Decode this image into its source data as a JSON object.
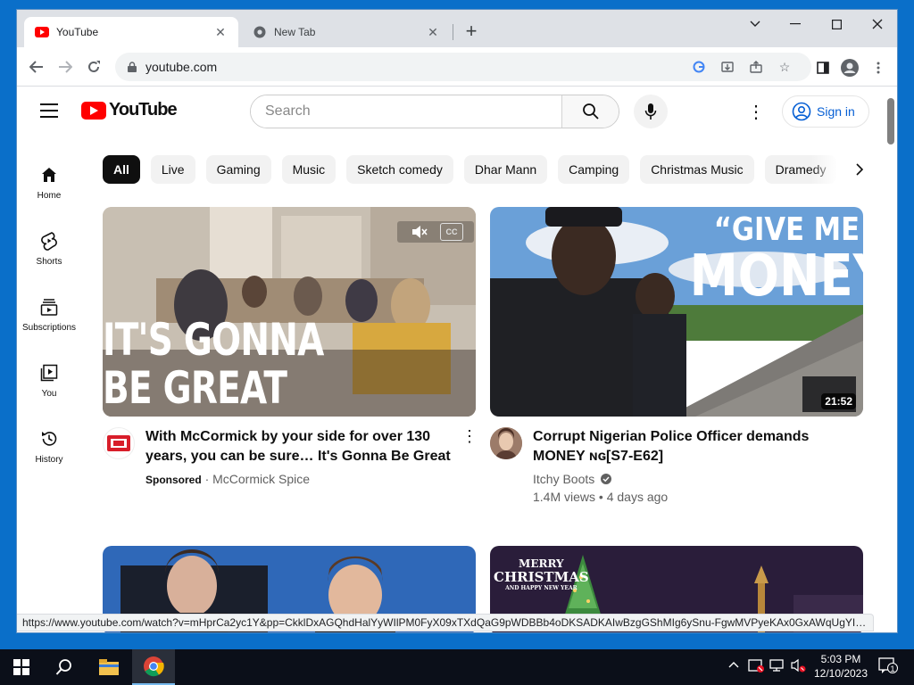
{
  "browser": {
    "tabs": [
      {
        "title": "YouTube",
        "active": true
      },
      {
        "title": "New Tab",
        "active": false
      }
    ],
    "address": "youtube.com",
    "status_url": "https://www.youtube.com/watch?v=mHprCa2yc1Y&pp=CkklDxAGQhdHalYyWIlPM0FyX09xTXdQaG9pWDBBb4oDKSADKAIwBzgGShMIg6ySnu-FgwMVPyeKAx0GxAWqUgYIBTAB..."
  },
  "youtube": {
    "logo_text": "YouTube",
    "search_placeholder": "Search",
    "signin_label": "Sign in",
    "chips": [
      "All",
      "Live",
      "Gaming",
      "Music",
      "Sketch comedy",
      "Dhar Mann",
      "Camping",
      "Christmas Music",
      "Dramedy"
    ],
    "sidenav": [
      {
        "label": "Home",
        "icon": "home-icon"
      },
      {
        "label": "Shorts",
        "icon": "shorts-icon"
      },
      {
        "label": "Subscriptions",
        "icon": "subscriptions-icon"
      },
      {
        "label": "You",
        "icon": "you-icon"
      },
      {
        "label": "History",
        "icon": "history-icon"
      }
    ],
    "videos": [
      {
        "title": "With McCormick by your side for over 130 years, you can be sure… It's Gonna Be Great",
        "sponsored_label": "Sponsored",
        "channel": "McCormick Spice",
        "thumb_text_line1": "IT'S GONNA",
        "thumb_text_line2": "BE GREAT",
        "cc_label": "CC"
      },
      {
        "title": "Corrupt Nigerian Police Officer demands MONEY ɴɢ[S7-E62]",
        "channel": "Itchy Boots",
        "views": "1.4M views",
        "age": "4 days ago",
        "duration": "21:52",
        "thumb_text_line1": "“GIVE ME",
        "thumb_text_line2": "MONEY”"
      },
      {
        "title": "",
        "thumb_text_line1": ""
      },
      {
        "title": "",
        "thumb_text_line1": "MERRY",
        "thumb_text_line2": "CHRISTMAS",
        "thumb_text_line3": "AND HAPPY NEW YEAR"
      }
    ]
  },
  "taskbar": {
    "time": "5:03 PM",
    "date": "12/10/2023",
    "notifications": "1"
  },
  "colors": {
    "youtube_red": "#ff0000",
    "link_blue": "#065fd4",
    "desktop_blue": "#0a6fc9"
  }
}
